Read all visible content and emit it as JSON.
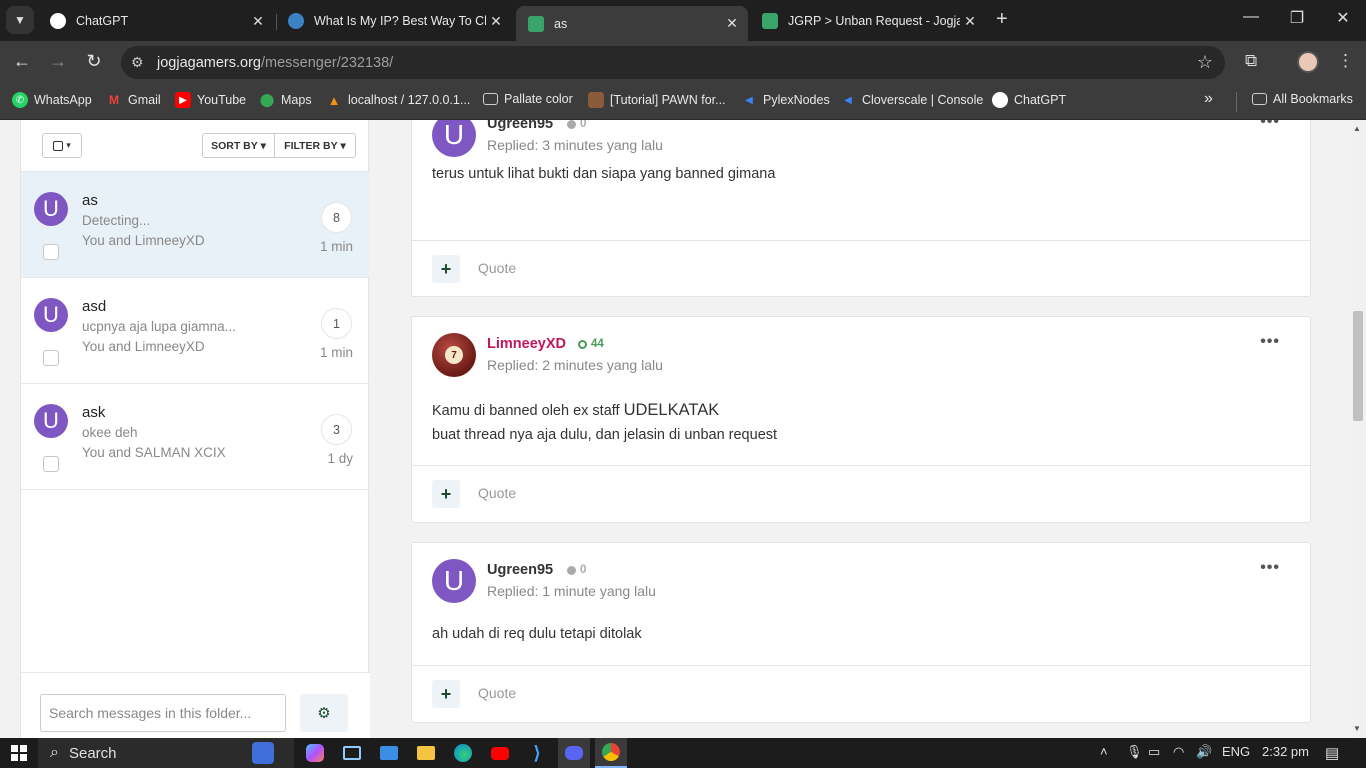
{
  "browser": {
    "tabs": [
      {
        "label": "ChatGPT",
        "favicon_color": "#ffffff",
        "active": false
      },
      {
        "label": "What Is My IP? Best Way To Che",
        "favicon_color": "#3b82c4",
        "active": false
      },
      {
        "label": "as",
        "favicon_color": "#3aa56b",
        "active": true
      },
      {
        "label": "JGRP > Unban Request - Jogjag",
        "favicon_color": "#3aa56b",
        "active": false
      }
    ],
    "url_domain": "jogjagamers.org",
    "url_path": "/messenger/232138/",
    "bookmarks": [
      {
        "label": "WhatsApp",
        "icon": "whatsapp-icon",
        "color": "#25d366"
      },
      {
        "label": "Gmail",
        "icon": "gmail-icon",
        "color": "#ea4335"
      },
      {
        "label": "YouTube",
        "icon": "youtube-icon",
        "color": "#ff0000"
      },
      {
        "label": "Maps",
        "icon": "maps-icon",
        "color": "#34a853"
      },
      {
        "label": "localhost / 127.0.0.1...",
        "icon": "phpmyadmin-icon",
        "color": "#f29111"
      },
      {
        "label": "Pallate color",
        "icon": "folder-icon",
        "color": "#cfcfcf"
      },
      {
        "label": "[Tutorial] PAWN for...",
        "icon": "pawn-icon",
        "color": "#8a5a3a"
      },
      {
        "label": "PylexNodes",
        "icon": "pylex-icon",
        "color": "#3b82f6"
      },
      {
        "label": "Cloverscale | Console",
        "icon": "cloverscale-icon",
        "color": "#3b82f6"
      },
      {
        "label": "ChatGPT",
        "icon": "chatgpt-icon",
        "color": "#ffffff"
      }
    ],
    "all_bookmarks": "All Bookmarks"
  },
  "sidebar": {
    "sort_label": "SORT BY",
    "filter_label": "FILTER BY",
    "conversations": [
      {
        "avatar": "U",
        "title": "as",
        "snippet": "Detecting...",
        "participants": "You and LimneeyXD",
        "count": "8",
        "time": "1 min",
        "active": true
      },
      {
        "avatar": "U",
        "title": "asd",
        "snippet": "ucpnya aja lupa giamna...",
        "participants": "You and LimneeyXD",
        "count": "1",
        "time": "1 min",
        "active": false
      },
      {
        "avatar": "U",
        "title": "ask",
        "snippet": "okee deh",
        "participants": "You and SALMAN XCIX",
        "count": "3",
        "time": "1 dy",
        "active": false
      }
    ],
    "search_placeholder": "Search messages in this folder..."
  },
  "messages": [
    {
      "avatar": "U",
      "username": "Ugreen95",
      "rep": "0",
      "replied": "Replied: 3 minutes yang lalu",
      "body_lines": [
        "terus untuk lihat bukti dan siapa yang banned gimana"
      ],
      "quote": "Quote"
    },
    {
      "avatar": "ball",
      "username": "LimneeyXD",
      "rep": "44",
      "replied": "Replied: 2 minutes yang lalu",
      "body_prefix": "Kamu di banned oleh ex staff ",
      "body_emph": "UDELKATAK",
      "body_lines": [
        "buat thread nya aja dulu, dan jelasin di unban request"
      ],
      "quote": "Quote"
    },
    {
      "avatar": "U",
      "username": "Ugreen95",
      "rep": "0",
      "replied": "Replied: 1 minute yang lalu",
      "body_lines": [
        "ah udah di req dulu tetapi ditolak"
      ],
      "quote": "Quote"
    }
  ],
  "taskbar": {
    "search_label": "Search",
    "lang": "ENG",
    "time": "2:32 pm"
  }
}
